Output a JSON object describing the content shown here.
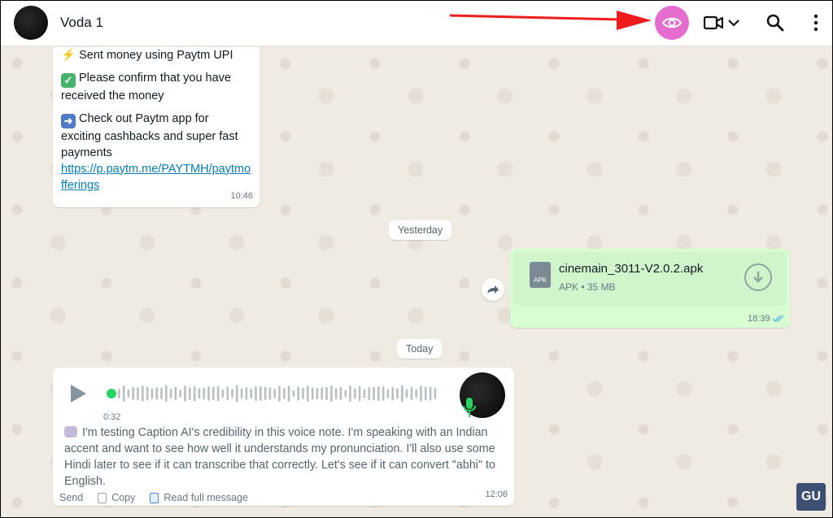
{
  "header": {
    "contact_name": "Voda 1"
  },
  "icons": {
    "eye": "eye-icon",
    "video": "video-call-icon",
    "search": "search-icon",
    "menu": "kebab-menu-icon"
  },
  "colors": {
    "eye_button": "#e56dcf",
    "annotation_arrow": "#ee1c1c",
    "outgoing_bubble": "#d9fdd3",
    "chat_background": "#efeae2",
    "voice_progress": "#25d366"
  },
  "messages": {
    "paytm": {
      "partial_line": "Sent money using Paytm UPI",
      "confirm": "Please confirm that you have received the money",
      "checkout": "Check out Paytm app for exciting cashbacks and super fast payments",
      "link": "https://p.paytm.me/PAYTMH/paytmofferings",
      "time": "10:46"
    },
    "date_yesterday": "Yesterday",
    "file": {
      "icon_label": "APK",
      "name": "cinemain_3011-V2.0.2.apk",
      "meta": "APK • 35 MB",
      "time": "18:39"
    },
    "date_today": "Today",
    "voice": {
      "duration": "0:32",
      "progress": 0,
      "transcript": "I'm testing Caption AI's credibility in this voice note. I'm speaking with an Indian accent and want to see how well it understands my pronunciation. I'll also use some Hindi later to see if it can transcribe that correctly. Let's see if it can convert \"abhi\" to English.",
      "time": "12:06",
      "actions": {
        "send": "Send",
        "copy": "Copy",
        "read_full": "Read full message"
      }
    }
  },
  "watermark": "GU"
}
